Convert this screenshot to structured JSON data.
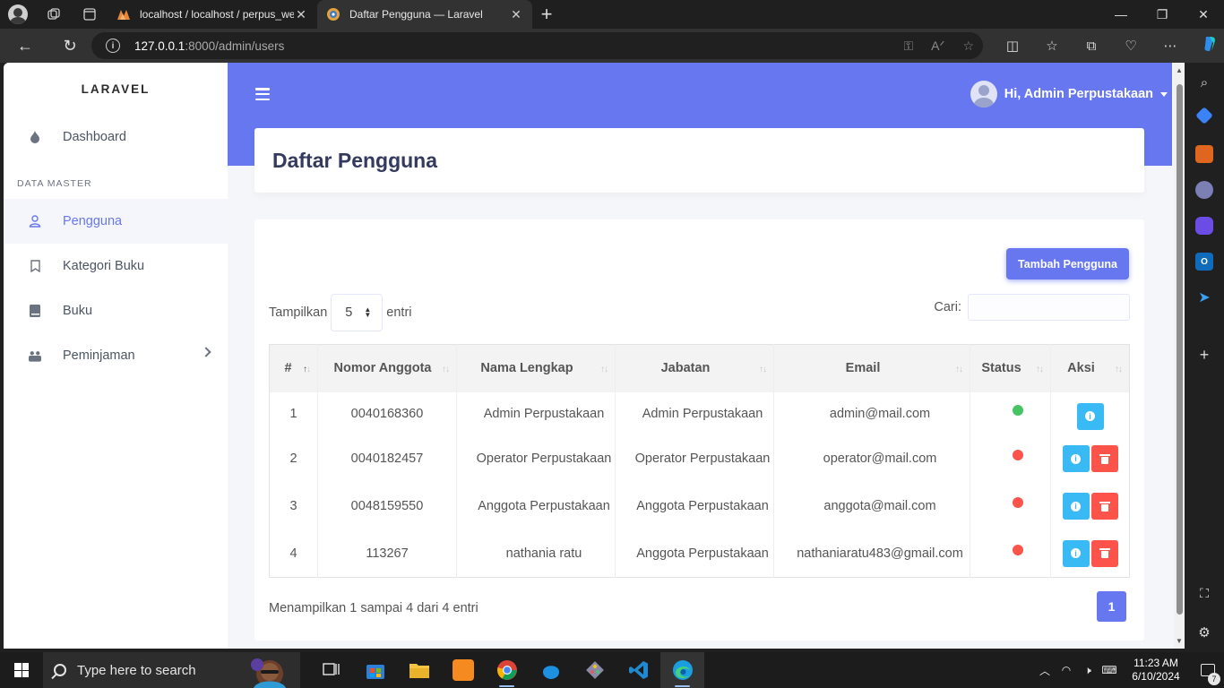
{
  "browser": {
    "tabs": [
      {
        "title": "localhost / localhost / perpus_we",
        "favicon": "phpmyadmin-icon",
        "active": false
      },
      {
        "title": "Daftar Pengguna — Laravel",
        "favicon": "laravel-globe-icon",
        "active": true
      }
    ],
    "url_host": "127.0.0.1",
    "url_path": ":8000/admin/users"
  },
  "sidebar": {
    "brand": "LARAVEL",
    "items": [
      {
        "label": "Dashboard",
        "icon": "fire-icon"
      },
      {
        "label": "Pengguna",
        "icon": "user-icon",
        "active": true
      },
      {
        "label": "Kategori Buku",
        "icon": "bookmark-icon"
      },
      {
        "label": "Buku",
        "icon": "book-icon"
      },
      {
        "label": "Peminjaman",
        "icon": "people-icon",
        "has_submenu": true
      }
    ],
    "section_header": "DATA MASTER"
  },
  "header": {
    "greeting": "Hi, Admin Perpustakaan"
  },
  "page": {
    "title": "Daftar Pengguna",
    "add_button": "Tambah Pengguna",
    "length_label_before": "Tampilkan",
    "length_value": "5",
    "length_label_after": "entri",
    "search_label": "Cari:",
    "info_text": "Menampilkan 1 sampai 4 dari 4 entri",
    "current_page": "1"
  },
  "table": {
    "columns": [
      "#",
      "Nomor Anggota",
      "Nama Lengkap",
      "Jabatan",
      "Email",
      "Status",
      "Aksi"
    ],
    "rows": [
      {
        "no": "1",
        "nomor": "0040168360",
        "nama": "Admin Perpustakaan",
        "jabatan": "Admin Perpustakaan",
        "email": "admin@mail.com",
        "status": "active",
        "deletable": false
      },
      {
        "no": "2",
        "nomor": "0040182457",
        "nama": "Operator Perpustakaan",
        "jabatan": "Operator Perpustakaan",
        "email": "operator@mail.com",
        "status": "inactive",
        "deletable": true
      },
      {
        "no": "3",
        "nomor": "0048159550",
        "nama": "Anggota Perpustakaan",
        "jabatan": "Anggota Perpustakaan",
        "email": "anggota@mail.com",
        "status": "inactive",
        "deletable": true
      },
      {
        "no": "4",
        "nomor": "113267",
        "nama": "nathania ratu",
        "jabatan": "Anggota Perpustakaan",
        "email": "nathaniaratu483@gmail.com",
        "status": "inactive",
        "deletable": true
      }
    ]
  },
  "taskbar": {
    "search_placeholder": "Type here to search",
    "time": "11:23 AM",
    "date": "6/10/2024",
    "notification_count": "7"
  },
  "colors": {
    "primary": "#6777ef",
    "info": "#3abaf4",
    "danger": "#fc544b",
    "success": "#47c363"
  }
}
